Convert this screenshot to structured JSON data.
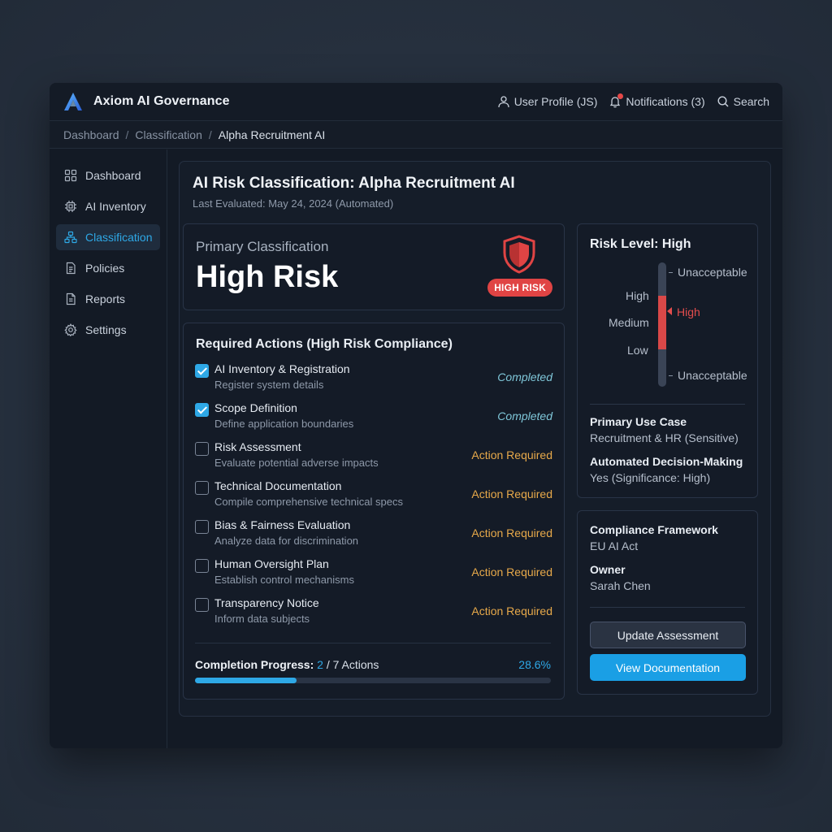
{
  "app": {
    "title": "Axiom AI Governance",
    "user_profile": "User Profile (JS)",
    "notifications": "Notifications (3)",
    "search": "Search",
    "accent": "#2ea8e6",
    "danger": "#e04444",
    "warning": "#e7a94a"
  },
  "breadcrumb": [
    "Dashboard",
    "Classification",
    "Alpha Recruitment AI"
  ],
  "breadcrumb_sep": "/",
  "sidebar": {
    "items": [
      {
        "label": "Dashboard",
        "icon": "grid-icon",
        "active": false
      },
      {
        "label": "AI Inventory",
        "icon": "chip-icon",
        "active": false
      },
      {
        "label": "Classification",
        "icon": "hierarchy-icon",
        "active": true
      },
      {
        "label": "Policies",
        "icon": "document-icon",
        "active": false
      },
      {
        "label": "Reports",
        "icon": "report-icon",
        "active": false
      },
      {
        "label": "Settings",
        "icon": "gear-icon",
        "active": false
      }
    ]
  },
  "page": {
    "title": "AI Risk Classification: Alpha Recruitment AI",
    "subtitle": "Last Evaluated: May 24, 2024 (Automated)"
  },
  "primary": {
    "label": "Primary Classification",
    "value": "High Risk",
    "badge": "HIGH RISK"
  },
  "actions": {
    "title": "Required Actions (High Risk Compliance)",
    "items": [
      {
        "name": "AI Inventory & Registration",
        "desc": "Register system details",
        "status": "Completed",
        "done": true
      },
      {
        "name": "Scope Definition",
        "desc": "Define application boundaries",
        "status": "Completed",
        "done": true
      },
      {
        "name": "Risk Assessment",
        "desc": "Evaluate potential adverse impacts",
        "status": "Action Required",
        "done": false
      },
      {
        "name": "Technical Documentation",
        "desc": "Compile comprehensive technical specs",
        "status": "Action Required",
        "done": false
      },
      {
        "name": "Bias & Fairness Evaluation",
        "desc": "Analyze data for discrimination",
        "status": "Action Required",
        "done": false
      },
      {
        "name": "Human Oversight Plan",
        "desc": "Establish control mechanisms",
        "status": "Action Required",
        "done": false
      },
      {
        "name": "Transparency Notice",
        "desc": "Inform data subjects",
        "status": "Action Required",
        "done": false
      }
    ],
    "progress_label": "Completion Progress:",
    "progress_done": "2",
    "progress_total": "/ 7 Actions",
    "progress_pct_text": "28.6%",
    "progress_fraction": 0.286
  },
  "risk": {
    "title": "Risk Level: High",
    "scale_top": "Unacceptable",
    "scale_high": "High",
    "scale_medium": "Medium",
    "scale_low": "Low",
    "scale_bottom": "Unacceptable",
    "marker_label": "High",
    "use_case_label": "Primary Use Case",
    "use_case_value": "Recruitment & HR (Sensitive)",
    "adm_label": "Automated Decision-Making",
    "adm_value": "Yes (Significance: High)"
  },
  "framework": {
    "label": "Compliance Framework",
    "value": "EU AI Act",
    "owner_label": "Owner",
    "owner_value": "Sarah Chen",
    "update_button": "Update Assessment",
    "docs_button": "View Documentation"
  }
}
